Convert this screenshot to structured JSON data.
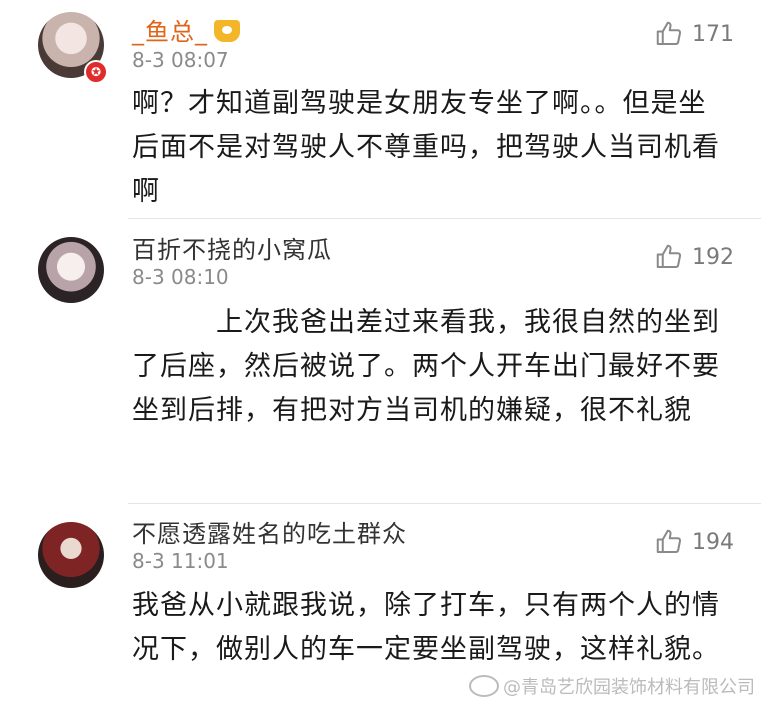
{
  "comments": [
    {
      "username": "_鱼总_",
      "time": "8-3 08:07",
      "likes": "171",
      "text": "啊？才知道副驾驶是女朋友专坐了啊。。但是坐后面不是对驾驶人不尊重吗，把驾驶人当司机看啊",
      "badge": "✪"
    },
    {
      "username": "百折不挠的小窝瓜",
      "time": "8-3 08:10",
      "likes": "192",
      "text": "　　　上次我爸出差过来看我，我很自然的坐到了后座，然后被说了。两个人开车出门最好不要坐到后排，有把对方当司机的嫌疑，很不礼貌"
    },
    {
      "username": "不愿透露姓名的吃土群众",
      "time": "8-3 11:01",
      "likes": "194",
      "text": "我爸从小就跟我说，除了打车，只有两个人的情况下，做别人的车一定要坐副驾驶，这样礼貌。"
    }
  ],
  "watermark": "@青岛艺欣园装饰材料有限公司",
  "colors": {
    "vip_name": "#e0651b",
    "crown": "#f2b628",
    "badge": "#e02b2b"
  },
  "icons": {
    "like": "thumbs-up-icon",
    "crown": "crown-icon",
    "weibo": "weibo-icon"
  }
}
